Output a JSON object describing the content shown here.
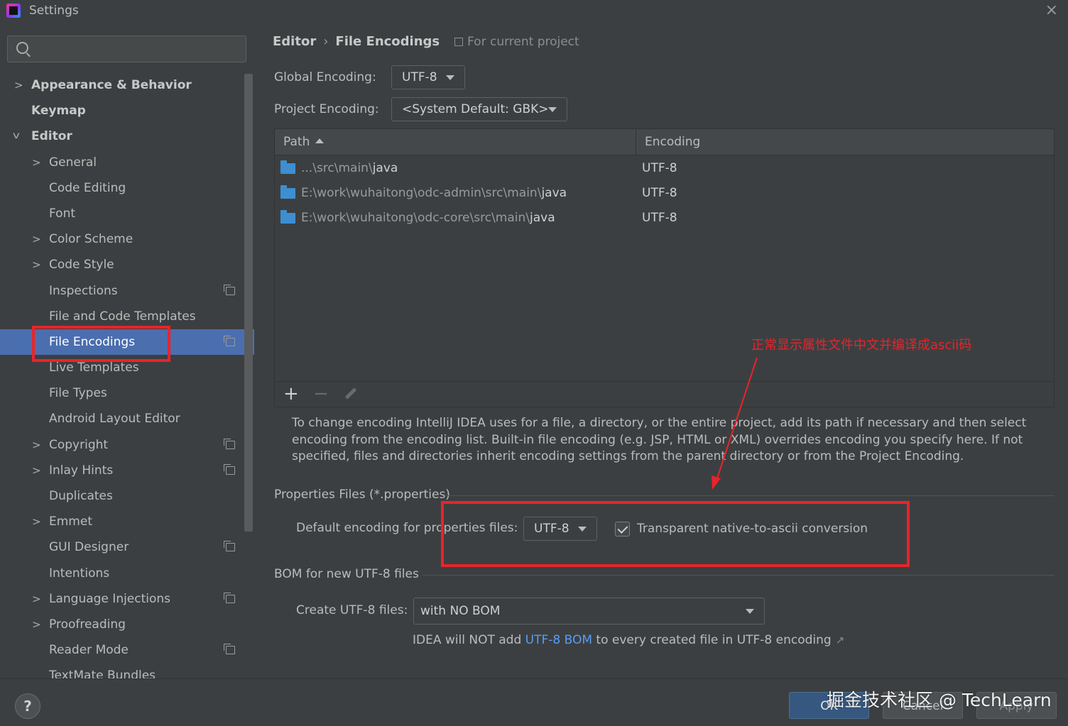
{
  "window": {
    "title": "Settings",
    "close": "×"
  },
  "search": {
    "value": "",
    "placeholder": ""
  },
  "sidebar": {
    "items": [
      {
        "label": "Appearance & Behavior",
        "chevron": ">",
        "level": 0,
        "bold": true,
        "scope_icon": false,
        "selected": false
      },
      {
        "label": "Keymap",
        "chevron": "",
        "level": 0,
        "bold": true,
        "scope_icon": false,
        "selected": false
      },
      {
        "label": "Editor",
        "chevron": "v",
        "level": 0,
        "bold": true,
        "scope_icon": false,
        "selected": false
      },
      {
        "label": "General",
        "chevron": ">",
        "level": 1,
        "bold": false,
        "scope_icon": false,
        "selected": false
      },
      {
        "label": "Code Editing",
        "chevron": "",
        "level": 1,
        "bold": false,
        "scope_icon": false,
        "selected": false
      },
      {
        "label": "Font",
        "chevron": "",
        "level": 1,
        "bold": false,
        "scope_icon": false,
        "selected": false
      },
      {
        "label": "Color Scheme",
        "chevron": ">",
        "level": 1,
        "bold": false,
        "scope_icon": false,
        "selected": false
      },
      {
        "label": "Code Style",
        "chevron": ">",
        "level": 1,
        "bold": false,
        "scope_icon": false,
        "selected": false
      },
      {
        "label": "Inspections",
        "chevron": "",
        "level": 1,
        "bold": false,
        "scope_icon": true,
        "selected": false
      },
      {
        "label": "File and Code Templates",
        "chevron": "",
        "level": 1,
        "bold": false,
        "scope_icon": false,
        "selected": false
      },
      {
        "label": "File Encodings",
        "chevron": "",
        "level": 1,
        "bold": false,
        "scope_icon": true,
        "selected": true
      },
      {
        "label": "Live Templates",
        "chevron": "",
        "level": 1,
        "bold": false,
        "scope_icon": false,
        "selected": false
      },
      {
        "label": "File Types",
        "chevron": "",
        "level": 1,
        "bold": false,
        "scope_icon": false,
        "selected": false
      },
      {
        "label": "Android Layout Editor",
        "chevron": "",
        "level": 1,
        "bold": false,
        "scope_icon": false,
        "selected": false
      },
      {
        "label": "Copyright",
        "chevron": ">",
        "level": 1,
        "bold": false,
        "scope_icon": true,
        "selected": false
      },
      {
        "label": "Inlay Hints",
        "chevron": ">",
        "level": 1,
        "bold": false,
        "scope_icon": true,
        "selected": false
      },
      {
        "label": "Duplicates",
        "chevron": "",
        "level": 1,
        "bold": false,
        "scope_icon": false,
        "selected": false
      },
      {
        "label": "Emmet",
        "chevron": ">",
        "level": 1,
        "bold": false,
        "scope_icon": false,
        "selected": false
      },
      {
        "label": "GUI Designer",
        "chevron": "",
        "level": 1,
        "bold": false,
        "scope_icon": true,
        "selected": false
      },
      {
        "label": "Intentions",
        "chevron": "",
        "level": 1,
        "bold": false,
        "scope_icon": false,
        "selected": false
      },
      {
        "label": "Language Injections",
        "chevron": ">",
        "level": 1,
        "bold": false,
        "scope_icon": true,
        "selected": false
      },
      {
        "label": "Proofreading",
        "chevron": ">",
        "level": 1,
        "bold": false,
        "scope_icon": false,
        "selected": false
      },
      {
        "label": "Reader Mode",
        "chevron": "",
        "level": 1,
        "bold": false,
        "scope_icon": true,
        "selected": false
      },
      {
        "label": "TextMate Bundles",
        "chevron": "",
        "level": 1,
        "bold": false,
        "scope_icon": false,
        "selected": false
      }
    ]
  },
  "breadcrumb": {
    "parent": "Editor",
    "separator": "›",
    "current": "File Encodings",
    "scope": "For current project"
  },
  "global_encoding": {
    "label": "Global Encoding:",
    "value": "UTF-8"
  },
  "project_encoding": {
    "label": "Project Encoding:",
    "value": "<System Default: GBK>"
  },
  "table": {
    "columns": {
      "path": "Path",
      "encoding": "Encoding"
    },
    "rows": [
      {
        "path_prefix": "...\\src\\main\\",
        "path_leaf": "java",
        "encoding": "UTF-8"
      },
      {
        "path_prefix": "E:\\work\\wuhaitong\\odc-admin\\src\\main\\",
        "path_leaf": "java",
        "encoding": "UTF-8"
      },
      {
        "path_prefix": "E:\\work\\wuhaitong\\odc-core\\src\\main\\",
        "path_leaf": "java",
        "encoding": "UTF-8"
      }
    ],
    "toolbar": {
      "add": "+",
      "remove": "−"
    }
  },
  "help_text": "To change encoding IntelliJ IDEA uses for a file, a directory, or the entire project, add its path if necessary and then select encoding from the encoding list. Built-in file encoding (e.g. JSP, HTML or XML) overrides encoding you specify here. If not specified, files and directories inherit encoding settings from the parent directory or from the Project Encoding.",
  "properties": {
    "section_title": "Properties Files (*.properties)",
    "default_label": "Default encoding for properties files:",
    "default_value": "UTF-8",
    "transparent_label": "Transparent native-to-ascii conversion",
    "transparent_checked": true
  },
  "bom": {
    "section_title": "BOM for new UTF-8 files",
    "create_label": "Create UTF-8 files:",
    "create_value": "with NO BOM",
    "note_before": "IDEA will NOT add ",
    "note_link": "UTF-8 BOM",
    "note_after": " to every created file in UTF-8 encoding",
    "ext_arrow": "↗"
  },
  "annotation": {
    "text": "正常显示属性文件中文并编译成ascii码",
    "color": "#e8242a"
  },
  "buttons": {
    "help": "?",
    "ok": "OK",
    "cancel": "Cancel",
    "apply": "Apply"
  },
  "watermark": "掘金技术社区 @ TechLearn",
  "colors": {
    "selection": "#4b6eaf",
    "link": "#589df6",
    "folder": "#3d8fd1",
    "annotation": "#e8242a"
  }
}
